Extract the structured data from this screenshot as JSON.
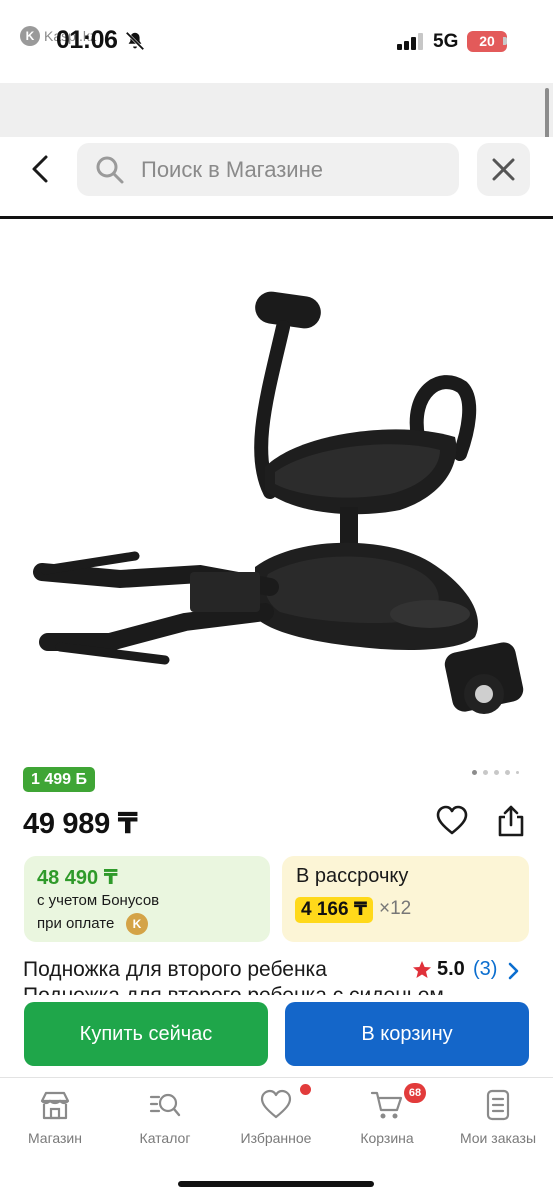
{
  "status_bar": {
    "back_app": "Kaspi.kz",
    "time": "01:06",
    "network": "5G",
    "battery": "20"
  },
  "search": {
    "placeholder": "Поиск в Магазине"
  },
  "product": {
    "image_alt": "Подножка для второго ребенка",
    "gallery_dots": 5,
    "bonus_badge": "1 499 Б",
    "price": "49 989 ₸",
    "bonus_card": {
      "price": "48 490 ₸",
      "line1": "с учетом Бонусов",
      "line2": "при оплате"
    },
    "credit_card": {
      "title": "В рассрочку",
      "monthly": "4 166 ₸",
      "months": "×12"
    },
    "title": "Подножка для второго ребенка",
    "title_second_line": "Подножка для второго ребенка с сиденьем",
    "rating": "5.0",
    "reviews": "(3)"
  },
  "actions": {
    "buy_now": "Купить сейчас",
    "add_to_cart": "В корзину"
  },
  "bottom_nav": {
    "items": [
      {
        "label": "Магазин",
        "icon": "shop-icon"
      },
      {
        "label": "Каталог",
        "icon": "catalog-search-icon"
      },
      {
        "label": "Избранное",
        "icon": "heart-icon"
      },
      {
        "label": "Корзина",
        "icon": "cart-icon"
      },
      {
        "label": "Мои заказы",
        "icon": "orders-icon"
      }
    ],
    "cart_count": "68"
  },
  "colors": {
    "green": "#1fa64a",
    "blue": "#1466c9",
    "bonus_green": "#3fa535",
    "credit_yellow": "#ffd91a",
    "alert_red": "#e23b3b"
  }
}
